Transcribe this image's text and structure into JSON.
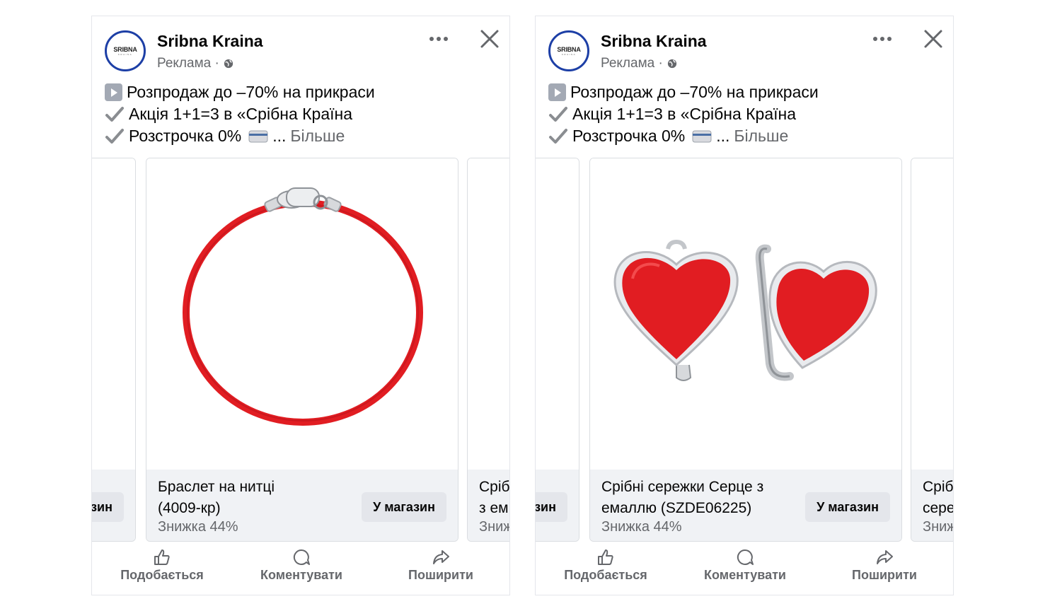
{
  "posts": [
    {
      "page_name": "Sribna Kraina",
      "sponsored": "Реклама ·",
      "logo_main": "SRIBNA",
      "logo_sub": "KRAINA",
      "caption": {
        "line1": "Розпродаж до –70% на прикраси",
        "line2": "Акція 1+1=3 в «Срібна Країна",
        "line3": "Розстрочка 0%",
        "ellipsis": "...",
        "more": "Більше"
      },
      "cards": {
        "prev": {
          "button": "У магазин"
        },
        "main": {
          "title_line1": "Браслет на нитці",
          "title_line2": "(4009-кр)",
          "subtitle": "Знижка 44%",
          "button": "У магазин"
        },
        "next": {
          "title_line1": "Сріб",
          "title_line2": "з ем",
          "subtitle": "Знижка"
        }
      },
      "actions": {
        "like": "Подобається",
        "comment": "Коментувати",
        "share": "Поширити"
      }
    },
    {
      "page_name": "Sribna Kraina",
      "sponsored": "Реклама ·",
      "logo_main": "SRIBNA",
      "logo_sub": "KRAINA",
      "caption": {
        "line1": "Розпродаж до –70% на прикраси",
        "line2": "Акція 1+1=3 в «Срібна Країна",
        "line3": "Розстрочка 0%",
        "ellipsis": "...",
        "more": "Більше"
      },
      "cards": {
        "prev": {
          "button": "У магазин"
        },
        "main": {
          "title_line1": "Срібні сережки Серце з",
          "title_line2": "емаллю (SZDE06225)",
          "subtitle": "Знижка 44%",
          "button": "У магазин"
        },
        "next": {
          "title_line1": "Сріб",
          "title_line2": "сере",
          "subtitle": "Знижка"
        }
      },
      "actions": {
        "like": "Подобається",
        "comment": "Коментувати",
        "share": "Поширити"
      }
    }
  ],
  "colors": {
    "accent_red": "#e11d22",
    "muted_text": "#65676b",
    "button_bg": "#e4e6eb",
    "info_bg": "#f0f2f5"
  }
}
